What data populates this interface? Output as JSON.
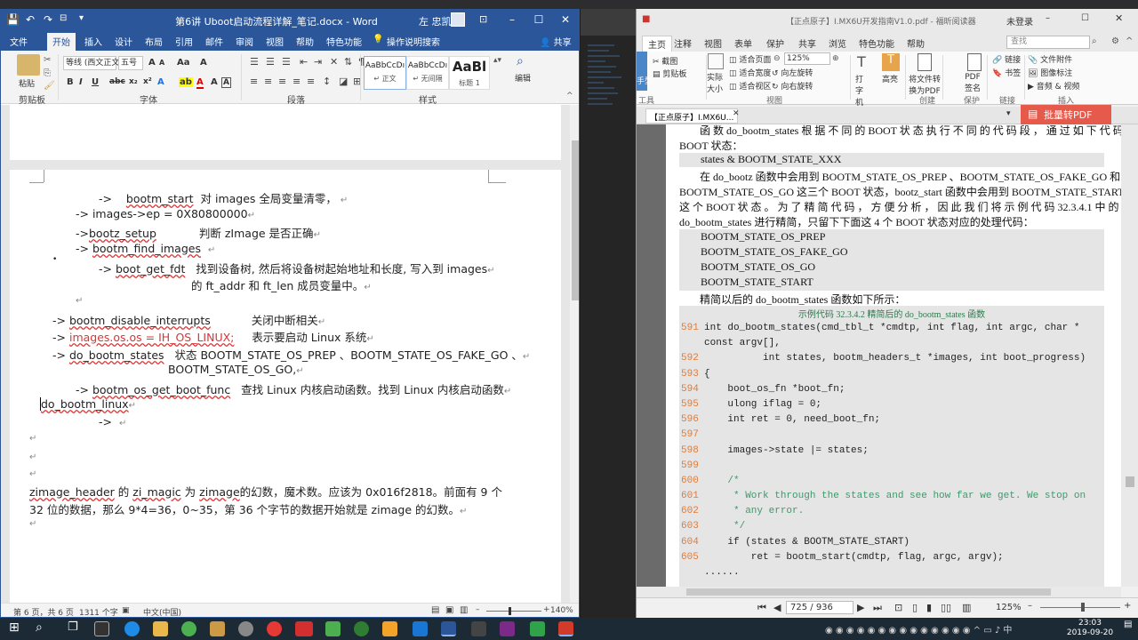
{
  "word": {
    "title": "第6讲 Uboot启动流程详解_笔记.docx - Word",
    "user": "左 忠凯",
    "tabs": [
      "文件",
      "开始",
      "插入",
      "设计",
      "布局",
      "引用",
      "邮件",
      "审阅",
      "视图",
      "帮助",
      "特色功能"
    ],
    "search_hint": "操作说明搜索",
    "share": "共享",
    "ribbon": {
      "paste": "粘贴",
      "clipboard": "剪贴板",
      "font_name": "等线 (西文正文",
      "font_size": "五号",
      "font_group": "字体",
      "paragraph_group": "段落",
      "styles_group": "样式",
      "edit": "编辑",
      "styles": [
        {
          "sample": "AaBbCcDı",
          "name": "↵ 正文"
        },
        {
          "sample": "AaBbCcDı",
          "name": "↵ 无间隔"
        },
        {
          "sample": "AaBl",
          "name": "标题 1"
        }
      ]
    },
    "doc_lines": {
      "l1_prefix": "->",
      "l1_fn": "bootm_start",
      "l1_text": "对 images 全局变量清零，",
      "l2": "-> images->ep = 0X80800000",
      "l3_prefix": "->",
      "l3_fn": "bootz_setup",
      "l3_text": "判断 zImage 是否正确",
      "l4_prefix": "->",
      "l4_fn": "bootm_find_images",
      "l5_prefix": "->",
      "l5_fn": "boot_get_fdt",
      "l5_text": "找到设备树, 然后将设备树起始地址和长度, 写入到 images",
      "l5b_text": "的 ft_addr 和 ft_len 成员变量中。",
      "l6_prefix": "->",
      "l6_fn": "bootm_disable_interrupts",
      "l6_text": "关闭中断相关",
      "l7_prefix": "->",
      "l7_fn": "images.os.os = IH_OS_LINUX;",
      "l7_text": "表示要启动 Linux 系统",
      "l8_prefix": "->",
      "l8_fn": "do_bootm_states",
      "l8_text": "状态 BOOTM_STATE_OS_PREP 、BOOTM_STATE_OS_FAKE_GO 、",
      "l8b_text": "BOOTM_STATE_OS_GO,",
      "l9_prefix": "->",
      "l9_fn": "bootm_os_get_boot_func",
      "l9_text": "查找 Linux 内核启动函数。找到 Linux 内核启动函数",
      "l10": "do_bootm_linux",
      "l11": "->",
      "p1_a": "zimage_header",
      "p1_b": "的",
      "p1_c": "zi_magic",
      "p1_d": "为",
      "p1_e": "zimage",
      "p1_f": "的幻数，魔术数。应该为 0x016f2818。前面有 9 个",
      "p2": "32 位的数据，那么 9*4=36，0~35，第 36 个字节的数据开始就是 zimage 的幻数。"
    },
    "status": {
      "page": "第 6 页，共 6 页",
      "words": "1311 个字",
      "lang": "中文(中国)",
      "zoom": "140%"
    }
  },
  "pdf": {
    "title": "【正点原子】I.MX6U开发指南V1.0.pdf - 福昕阅读器",
    "login": "未登录",
    "tabs": [
      "主页",
      "注释",
      "视图",
      "表单",
      "保护",
      "共享",
      "浏览",
      "特色功能",
      "帮助"
    ],
    "search_placeholder": "查找",
    "ribbon": {
      "hand": "手型",
      "screenshot": "截图",
      "clipboard": "剪贴板",
      "actual_size": "实际大小",
      "fit_page": "适合页面",
      "fit_width": "适合宽度",
      "fit_view": "适合视区",
      "zoom": "125%",
      "rotate_left": "向左旋转",
      "rotate_right": "向右旋转",
      "type": "打字机",
      "highlight": "高亮",
      "convert": "将文件转换为PDF",
      "sign": "PDF签名",
      "link": "链接",
      "bookmark": "书签",
      "attach": "文件附件",
      "image_mark": "图像标注",
      "audio": "音频 & 视频",
      "tools": "工具",
      "view": "视图",
      "create": "创建",
      "protect": "保护",
      "links": "链接",
      "insert": "插入"
    },
    "doc_tab": "【正点原子】I.MX6U...",
    "batch": "批量转PDF",
    "text": {
      "t1": "函 数  do_bootm_states  根 据 不 同 的  BOOT  状 态 执 行 不 同 的 代 码 段 ， 通 过 如 下 代 码 来 判 断",
      "t2": "BOOT 状态：",
      "g1": "states & BOOTM_STATE_XXX",
      "t3": "在 do_bootz 函数中会用到 BOOTM_STATE_OS_PREP 、BOOTM_STATE_OS_FAKE_GO 和",
      "t4": "BOOTM_STATE_OS_GO 这三个 BOOT 状态，bootz_start 函数中会用到 BOOTM_STATE_START",
      "t5": "这 个  BOOT  状 态 。 为 了 精 简 代 码 ， 方 便 分 析 ， 因 此 我 们 将 示 例 代 码  32.3.4.1  中 的 函 数",
      "t6": "do_bootm_states 进行精简，只留下下面这 4 个 BOOT 状态对应的处理代码：",
      "s1": "BOOTM_STATE_OS_PREP",
      "s2": "BOOTM_STATE_OS_FAKE_GO",
      "s3": "BOOTM_STATE_OS_GO",
      "s4": "BOOTM_STATE_START",
      "t7": "精简以后的 do_bootm_states 函数如下所示：",
      "caption": "示例代码 32.3.4.2  精简后的 do_bootm_states 函数"
    },
    "code": [
      {
        "n": "591",
        "t": "int do_bootm_states(cmd_tbl_t *cmdtp, int flag, int argc, char *"
      },
      {
        "n": "",
        "t": "const argv[],"
      },
      {
        "n": "592",
        "t": "          int states, bootm_headers_t *images, int boot_progress)"
      },
      {
        "n": "593",
        "t": "{"
      },
      {
        "n": "594",
        "t": "    boot_os_fn *boot_fn;"
      },
      {
        "n": "595",
        "t": "    ulong iflag = 0;"
      },
      {
        "n": "596",
        "t": "    int ret = 0, need_boot_fn;"
      },
      {
        "n": "597",
        "t": ""
      },
      {
        "n": "598",
        "t": "    images->state |= states;"
      },
      {
        "n": "599",
        "t": ""
      },
      {
        "n": "600",
        "t": "    /*"
      },
      {
        "n": "601",
        "t": "     * Work through the states and see how far we get. We stop on"
      },
      {
        "n": "602",
        "t": "     * any error."
      },
      {
        "n": "603",
        "t": "     */"
      },
      {
        "n": "604",
        "t": "    if (states & BOOTM_STATE_START)"
      },
      {
        "n": "605",
        "t": "        ret = bootm_start(cmdtp, flag, argc, argv);"
      },
      {
        "n": "",
        "t": "......"
      }
    ],
    "status": {
      "page": "725 / 936",
      "zoom": "125%"
    }
  },
  "taskbar": {
    "time": "23:03",
    "date": "2019-09-20"
  }
}
